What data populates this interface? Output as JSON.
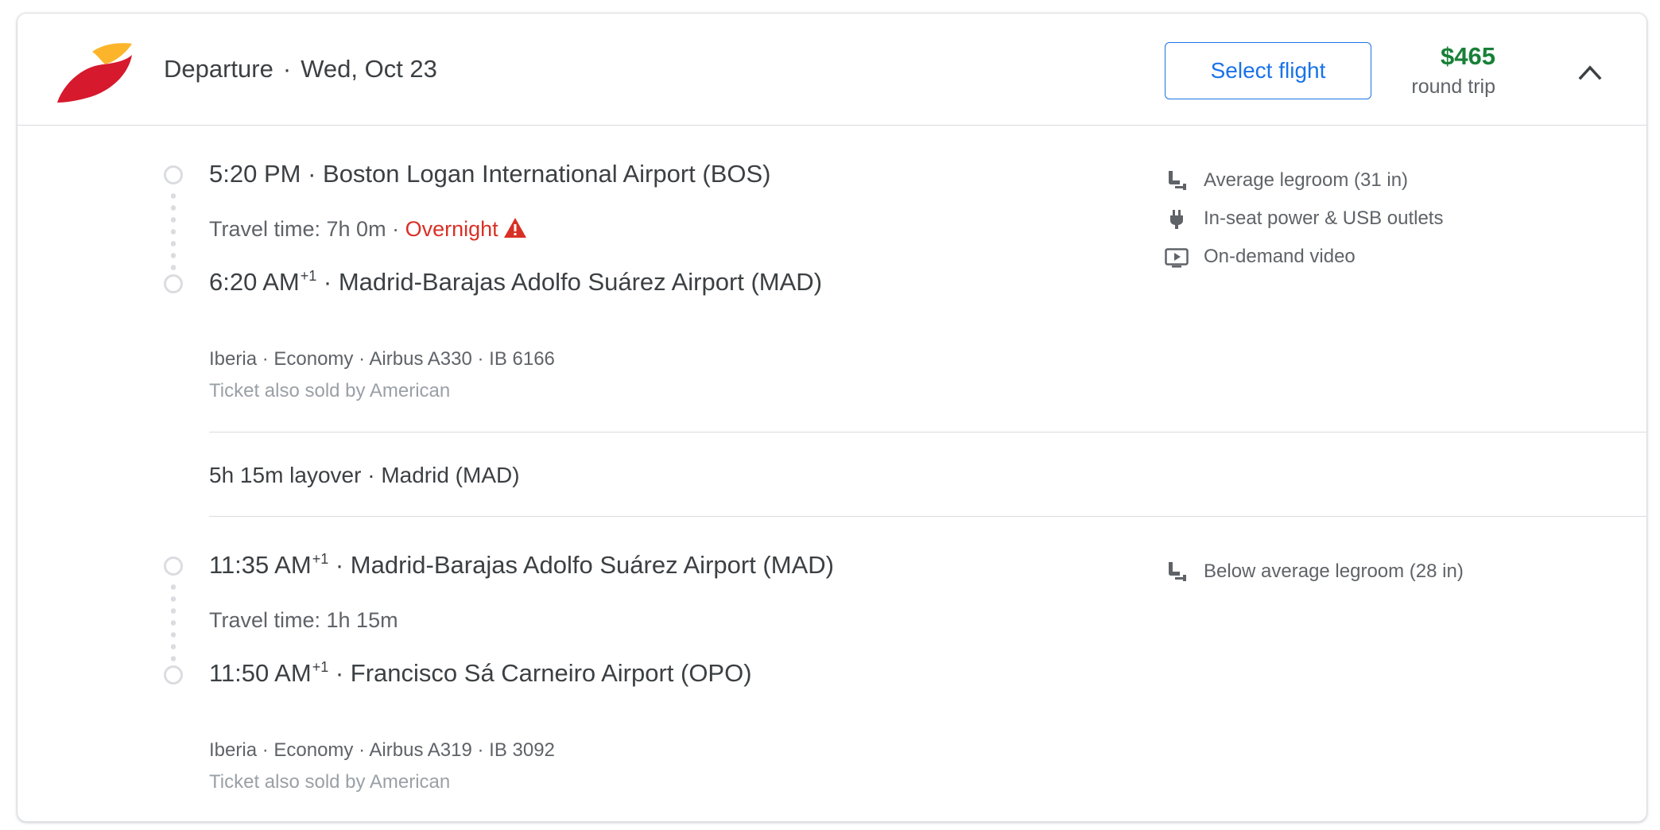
{
  "header": {
    "airline_icon": "iberia-logo-icon",
    "direction": "Departure",
    "separator": "·",
    "date": "Wed, Oct 23",
    "select_label": "Select flight",
    "price": "$465",
    "price_subtitle": "round trip",
    "collapse_icon": "chevron-up-icon"
  },
  "colors": {
    "accent": "#1a73e8",
    "price": "#188038",
    "warning": "#d93025",
    "logo_red": "#d7192d",
    "logo_yellow": "#fcb52b"
  },
  "segments": [
    {
      "departure_time": "5:20 PM",
      "departure_sup": "",
      "departure_airport": "· Boston Logan International Airport (BOS)",
      "travel_time": "Travel time: 7h 0m",
      "travel_sep": " · ",
      "overnight_label": "Overnight",
      "arrival_time": "6:20 AM",
      "arrival_sup": "+1",
      "arrival_airport": "· Madrid-Barajas Adolfo Suárez Airport (MAD)",
      "details": "Iberia · Economy · Airbus A330 · IB 6166",
      "sold_by": "Ticket also sold by American",
      "amenities": [
        {
          "icon": "legroom-seat-icon",
          "label": "Average legroom (31 in)"
        },
        {
          "icon": "power-plug-icon",
          "label": "In-seat power & USB outlets"
        },
        {
          "icon": "video-play-icon",
          "label": "On-demand video"
        }
      ]
    },
    {
      "departure_time": "11:35 AM",
      "departure_sup": "+1",
      "departure_airport": "· Madrid-Barajas Adolfo Suárez Airport (MAD)",
      "travel_time": "Travel time: 1h 15m",
      "arrival_time": "11:50 AM",
      "arrival_sup": "+1",
      "arrival_airport": "· Francisco Sá Carneiro Airport (OPO)",
      "details": "Iberia · Economy · Airbus A319 · IB 3092",
      "sold_by": "Ticket also sold by American",
      "amenities": [
        {
          "icon": "legroom-seat-icon",
          "label": "Below average legroom (28 in)"
        }
      ]
    }
  ],
  "layover": {
    "label": "5h 15m layover · Madrid (MAD)"
  }
}
